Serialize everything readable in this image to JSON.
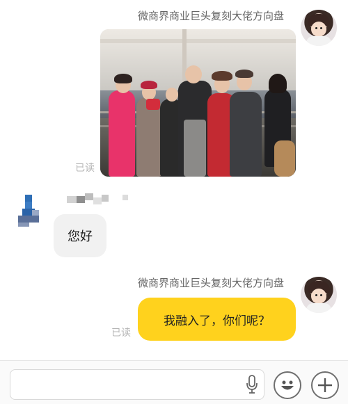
{
  "messages": {
    "first": {
      "sender": "微商界商业巨头复刻大佬方向盘",
      "receipt": "已读"
    },
    "incoming": {
      "text": "您好"
    },
    "second": {
      "sender": "微商界商业巨头复刻大佬方向盘",
      "text": "我融入了，你们呢？",
      "receipt": "已读"
    }
  },
  "composer": {
    "mic_icon": "microphone-icon",
    "emoji_icon": "smiley-icon",
    "add_icon": "plus-icon"
  },
  "colors": {
    "my_bubble": "#ffd21d",
    "their_bubble": "#f1f1f1",
    "receipt": "#b5b5b5"
  }
}
